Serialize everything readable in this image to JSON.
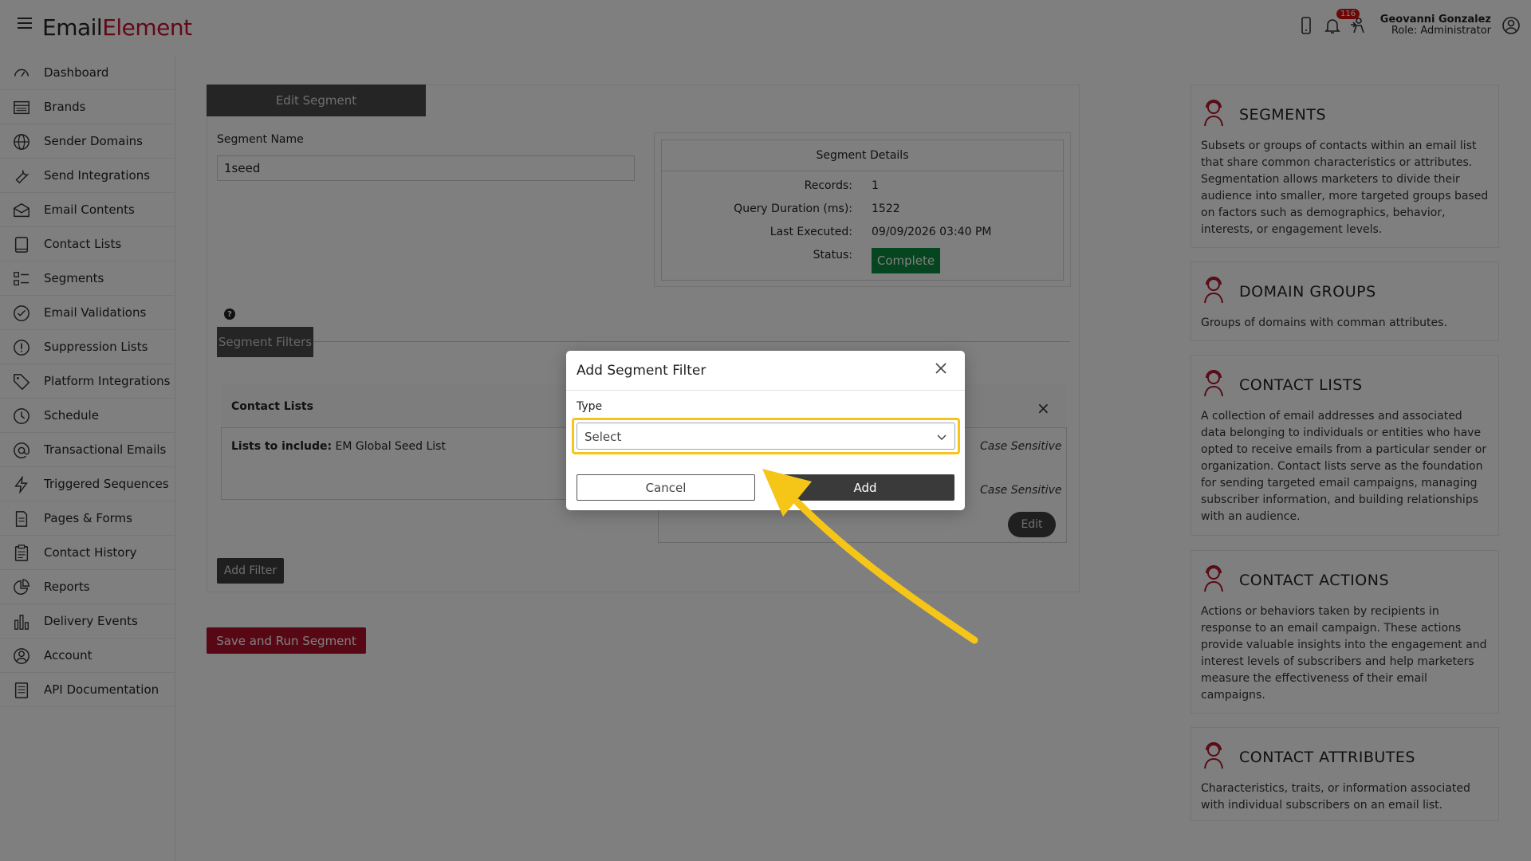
{
  "app": {
    "logo_part1": "Em",
    "logo_part2": "ail",
    "logo_part3": "Element",
    "notification_count": "116",
    "user_name": "Geovanni Gonzalez",
    "user_role": "Role: Administrator"
  },
  "sidebar": {
    "items": [
      {
        "label": "Dashboard",
        "icon": "dashboard-icon"
      },
      {
        "label": "Brands",
        "icon": "brands-icon"
      },
      {
        "label": "Sender Domains",
        "icon": "globe-icon"
      },
      {
        "label": "Send Integrations",
        "icon": "wrench-icon"
      },
      {
        "label": "Email Contents",
        "icon": "envelope-icon"
      },
      {
        "label": "Contact Lists",
        "icon": "book-icon"
      },
      {
        "label": "Segments",
        "icon": "list-icon"
      },
      {
        "label": "Email Validations",
        "icon": "check-circle-icon"
      },
      {
        "label": "Suppression Lists",
        "icon": "exclamation-circle-icon"
      },
      {
        "label": "Platform Integrations",
        "icon": "tag-icon"
      },
      {
        "label": "Schedule",
        "icon": "clock-icon"
      },
      {
        "label": "Transactional Emails",
        "icon": "at-icon"
      },
      {
        "label": "Triggered Sequences",
        "icon": "lightning-icon"
      },
      {
        "label": "Pages & Forms",
        "icon": "document-icon"
      },
      {
        "label": "Contact History",
        "icon": "clipboard-icon"
      },
      {
        "label": "Reports",
        "icon": "pie-chart-icon"
      },
      {
        "label": "Delivery Events",
        "icon": "bar-chart-icon"
      },
      {
        "label": "Account",
        "icon": "user-circle-icon"
      },
      {
        "label": "API Documentation",
        "icon": "api-doc-icon"
      }
    ]
  },
  "main": {
    "tab_label": "Edit Segment",
    "segment_name_label": "Segment Name",
    "segment_name_value": "1seed",
    "details": {
      "title": "Segment Details",
      "records_label": "Records:",
      "records_value": "1",
      "duration_label": "Query Duration (ms):",
      "duration_value": "1522",
      "last_executed_label": "Last Executed:",
      "last_executed_value": "09/09/2026 03:40 PM",
      "status_label": "Status:",
      "status_value": "Complete"
    },
    "help_glyph": "?",
    "filters_tab_label": "Segment Filters",
    "filter_card": {
      "title": "Contact Lists",
      "lists_label": "Lists to include:",
      "lists_value": "EM Global Seed List",
      "case_sensitive_1": "Case Sensitive",
      "case_sensitive_2": "Case Sensitive",
      "edit_label": "Edit"
    },
    "add_filter_label": "Add Filter",
    "save_run_label": "Save and Run Segment"
  },
  "info_panel": [
    {
      "title": "SEGMENTS",
      "text": "Subsets or groups of contacts within an email list that share common characteristics or attributes. Segmentation allows marketers to divide their audience into smaller, more targeted groups based on factors such as demographics, behavior, interests, or engagement levels."
    },
    {
      "title": "DOMAIN GROUPS",
      "text": "Groups of domains with comman attributes."
    },
    {
      "title": "CONTACT LISTS",
      "text": "A collection of email addresses and associated data belonging to individuals or entities who have opted to receive emails from a particular sender or organization. Contact lists serve as the foundation for sending targeted email campaigns, managing subscriber information, and building relationships with an audience."
    },
    {
      "title": "CONTACT ACTIONS",
      "text": "Actions or behaviors taken by recipients in response to an email campaign. These actions provide valuable insights into the engagement and interest levels of subscribers and help marketers measure the effectiveness of their email campaigns."
    },
    {
      "title": "CONTACT ATTRIBUTES",
      "text": "Characteristics, traits, or information associated with individual subscribers on an email list."
    }
  ],
  "modal": {
    "title": "Add Segment Filter",
    "type_label": "Type",
    "select_placeholder": "Select",
    "cancel_label": "Cancel",
    "add_label": "Add"
  },
  "colors": {
    "brand_red": "#c8102e",
    "highlight_yellow": "#f5c518",
    "status_green": "#0b8a3e"
  }
}
